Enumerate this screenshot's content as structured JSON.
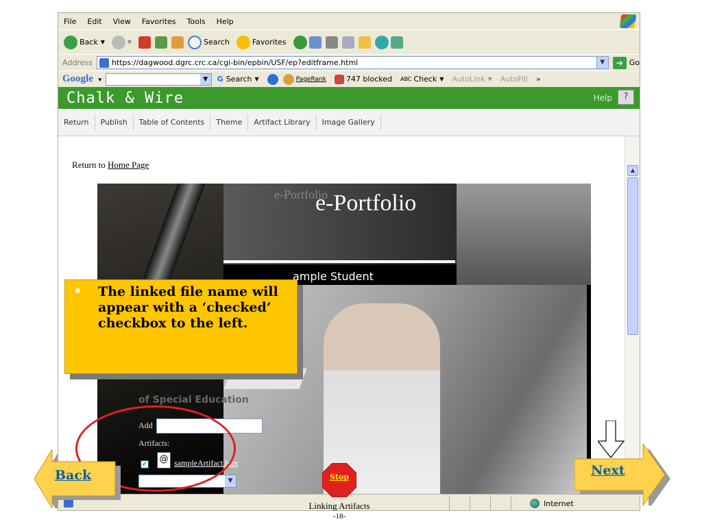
{
  "browser": {
    "menu": [
      "File",
      "Edit",
      "View",
      "Favorites",
      "Tools",
      "Help"
    ],
    "toolbar": {
      "back": "Back",
      "search": "Search",
      "favorites": "Favorites"
    },
    "address": {
      "label": "Address",
      "url": "https://dagwood.dgrc.crc.ca/cgi-bin/epbin/USF/ep?editframe.html",
      "go": "Go"
    },
    "google_bar": {
      "logo": "Google",
      "search": "Search",
      "pagerank": "PageRank",
      "blocked": "747 blocked",
      "check": "Check",
      "autolink": "AutoLink",
      "autofill": "AutoFill",
      "more": "»"
    },
    "status": {
      "zone": "Internet"
    }
  },
  "app": {
    "title": "Chalk & Wire",
    "help": "Help",
    "help_button": "?",
    "nav": [
      "Return",
      "Publish",
      "Table of Contents",
      "Theme",
      "Artifact Library",
      "Image Gallery"
    ]
  },
  "content": {
    "return_prefix": "Return to ",
    "return_link": "Home Page",
    "portfolio": {
      "ghost_title": "e-Portfolio",
      "title": "e-Portfolio",
      "student_name": "ample Student",
      "department": "of Special Education",
      "add_label": "Add",
      "artifacts_label": "Artifacts:",
      "file_icon_glyph": "@",
      "artifact_link": "sampleArtifact.htm"
    }
  },
  "slide": {
    "callout_bullet": "•",
    "callout_text": "The linked file name will appear with a ‘checked’ checkbox to the left.",
    "back": "Back",
    "next": "Next",
    "stop": "Stop",
    "caption": "Linking Artifacts",
    "page_number": "-18-",
    "colors": {
      "callout": "#ffc600",
      "arrow": "#ffd24d",
      "header_green": "#3c9a2c",
      "highlight_red": "#e02020"
    }
  }
}
